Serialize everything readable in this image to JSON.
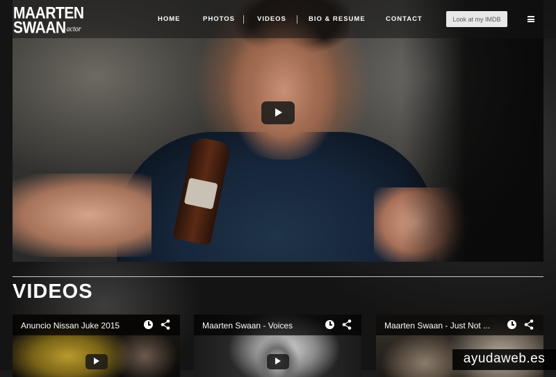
{
  "site": {
    "logo_line1": "MAARTEN",
    "logo_line2": "SWAAN",
    "logo_sub": "actor"
  },
  "nav": {
    "items": [
      {
        "label": "HOME"
      },
      {
        "label": "PHOTOS"
      },
      {
        "label": "VIDEOS"
      },
      {
        "label": "BIO & RESUME"
      },
      {
        "label": "CONTACT"
      }
    ],
    "cta_label": "Look at my IMDB",
    "menu_icon": "hamburger-menu-icon"
  },
  "hero": {
    "play_icon": "play-icon"
  },
  "videos_section": {
    "title": "VIDEOS",
    "cards": [
      {
        "title": "Anuncio Nissan Juke 2015"
      },
      {
        "title": "Maarten Swaan - Voices"
      },
      {
        "title": "Maarten Swaan - Just Not ..."
      }
    ],
    "icons": [
      "clock-icon",
      "share-icon",
      "play-icon"
    ]
  },
  "watermark": "ayudaweb.es",
  "colors": {
    "header_bg": "#141414",
    "cta_bg": "#e8e8e8",
    "cta_text": "#555555",
    "divider": "#c8c8c8",
    "text": "#ffffff"
  }
}
